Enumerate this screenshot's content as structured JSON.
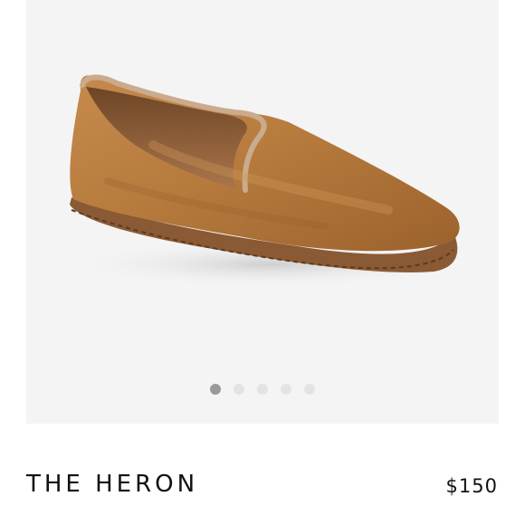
{
  "product": {
    "title": "THE HERON",
    "price": "$150",
    "image_icon": "velvet-loafer-image"
  },
  "gallery": {
    "slide_count": 5,
    "active_slide": 1
  },
  "colors": {
    "background": "#f4f4f4",
    "dot_active": "#9a9a9a",
    "dot_inactive": "#e3e3e3",
    "velvet": "#b77b3e",
    "piping": "#c9ab8d"
  }
}
